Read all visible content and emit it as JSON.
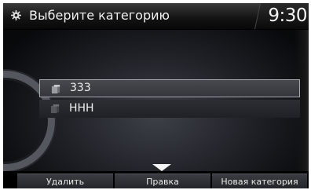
{
  "header": {
    "title": "Выберите категорию",
    "clock": "9:30"
  },
  "categories": [
    {
      "label": "333",
      "icon": "category-icon",
      "selected": true
    },
    {
      "label": "HHH",
      "icon": "category-icon",
      "selected": false
    }
  ],
  "footer": {
    "delete_label": "Удалить",
    "edit_label": "Правка",
    "new_category_label": "Новая категория"
  },
  "colors": {
    "background": "#050507",
    "selection_border": "#a5a8ae",
    "text": "#f0f0f0"
  }
}
